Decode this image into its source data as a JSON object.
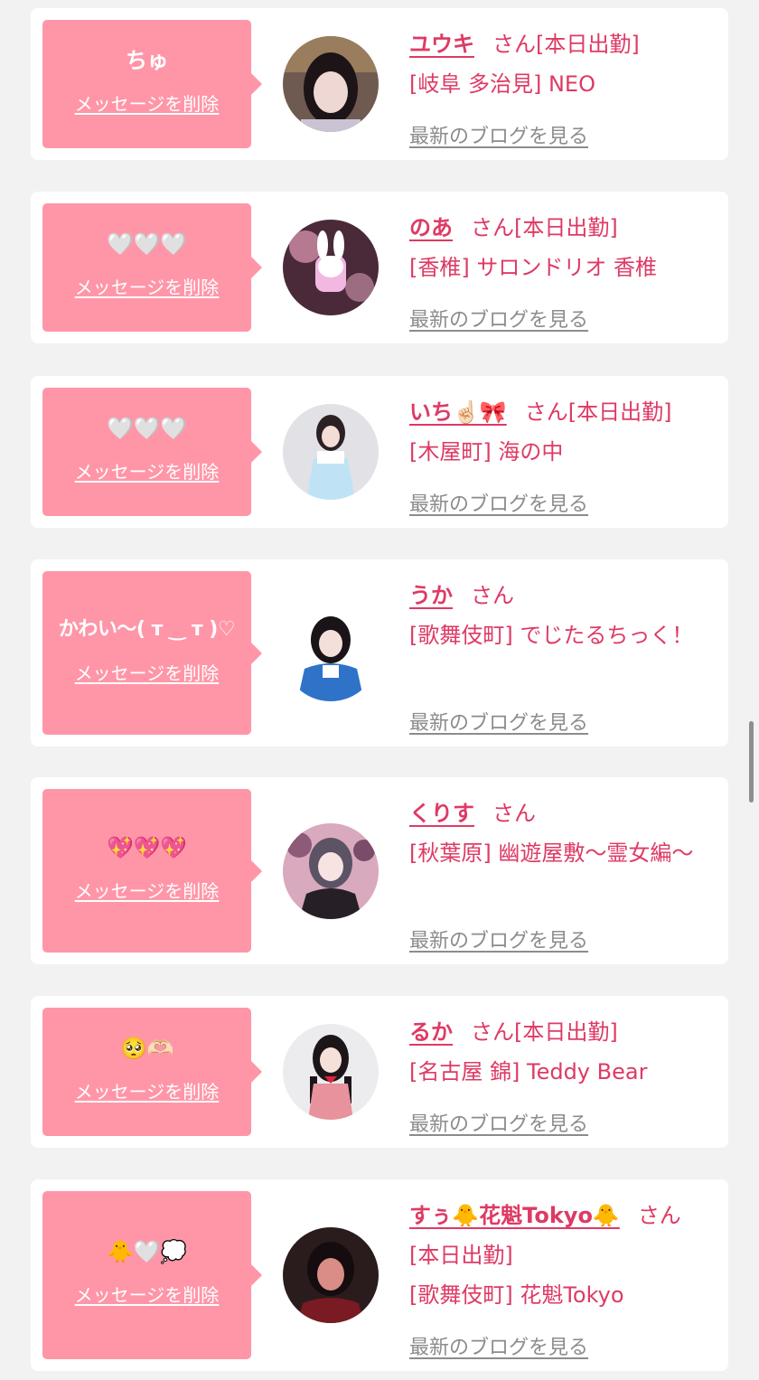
{
  "labels": {
    "delete_message": "メッセージを削除",
    "honorific": "さん",
    "view_blog": "最新のブログを見る"
  },
  "cards": [
    {
      "message": "ちゅ",
      "name": "ユウキ",
      "status": "[本日出勤]",
      "location": "[岐阜 多治見] NEO",
      "avatar_icon": "photo-dark-hair-girl"
    },
    {
      "message": "🤍🤍🤍",
      "name": "のあ",
      "status": "[本日出勤]",
      "location": "[香椎] サロンドリオ 香椎",
      "avatar_icon": "photo-pink-bunny-plush"
    },
    {
      "message": "🤍🤍🤍",
      "name": "いち☝🏻🎀",
      "status": "[本日出勤]",
      "location": "[木屋町] 海の中",
      "avatar_icon": "photo-idol-white-dress"
    },
    {
      "message": "かわい〜( ᴛ ‿ ᴛ )♡",
      "name": "うか",
      "status": "",
      "location": "[歌舞伎町] でじたるちっく！",
      "avatar_icon": "photo-idol-blue-outfit"
    },
    {
      "message": "💖💖💖",
      "name": "くりす",
      "status": "",
      "location": "[秋葉原] 幽遊屋敷〜霊女編〜",
      "avatar_icon": "photo-idol-pink-background"
    },
    {
      "message": "🥺🫶🏻",
      "name": "るか",
      "status": "[本日出勤]",
      "location": "[名古屋 錦] Teddy Bear",
      "avatar_icon": "photo-idol-red-check-dress"
    },
    {
      "message": "🐥🤍💭",
      "name": "すぅ🐥花魁Tokyo🐥",
      "status": "[本日出勤]",
      "location": "[歌舞伎町] 花魁Tokyo",
      "avatar_icon": "photo-girl-red-light"
    }
  ]
}
